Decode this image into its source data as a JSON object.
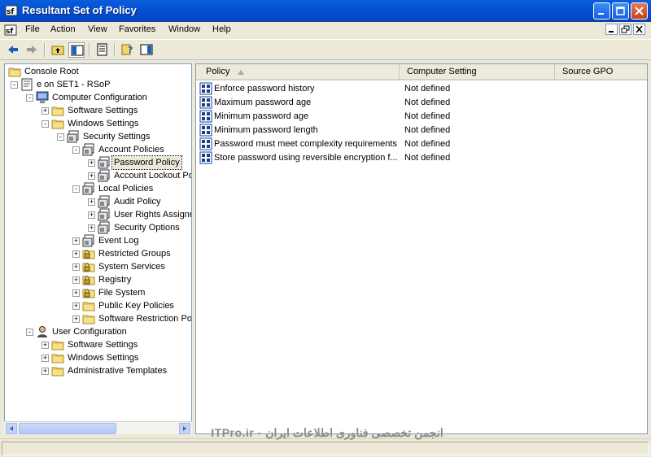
{
  "window": {
    "title": "Resultant Set of Policy"
  },
  "menu": [
    "File",
    "Action",
    "View",
    "Favorites",
    "Window",
    "Help"
  ],
  "tree": [
    {
      "label": "Console Root",
      "level": 0,
      "expander": "",
      "icon": "folder-icon"
    },
    {
      "label": "e on SET1 - RSoP",
      "level": 0,
      "expander": "-",
      "icon": "rsop-icon"
    },
    {
      "label": "Computer Configuration",
      "level": 1,
      "expander": "-",
      "icon": "computer-icon"
    },
    {
      "label": "Software Settings",
      "level": 2,
      "expander": "+",
      "icon": "folder-icon"
    },
    {
      "label": "Windows Settings",
      "level": 2,
      "expander": "-",
      "icon": "folder-icon"
    },
    {
      "label": "Security Settings",
      "level": 3,
      "expander": "-",
      "icon": "security-settings-icon"
    },
    {
      "label": "Account Policies",
      "level": 4,
      "expander": "-",
      "icon": "security-settings-icon"
    },
    {
      "label": "Password Policy",
      "level": 5,
      "expander": "+",
      "icon": "security-settings-icon",
      "selected": true
    },
    {
      "label": "Account Lockout Po",
      "level": 5,
      "expander": "+",
      "icon": "security-settings-icon"
    },
    {
      "label": "Local Policies",
      "level": 4,
      "expander": "-",
      "icon": "security-settings-icon"
    },
    {
      "label": "Audit Policy",
      "level": 5,
      "expander": "+",
      "icon": "security-settings-icon"
    },
    {
      "label": "User Rights Assignr",
      "level": 5,
      "expander": "+",
      "icon": "security-settings-icon"
    },
    {
      "label": "Security Options",
      "level": 5,
      "expander": "+",
      "icon": "security-settings-icon"
    },
    {
      "label": "Event Log",
      "level": 4,
      "expander": "+",
      "icon": "security-settings-icon"
    },
    {
      "label": "Restricted Groups",
      "level": 4,
      "expander": "+",
      "icon": "lock-folder-icon"
    },
    {
      "label": "System Services",
      "level": 4,
      "expander": "+",
      "icon": "lock-folder-icon"
    },
    {
      "label": "Registry",
      "level": 4,
      "expander": "+",
      "icon": "lock-folder-icon"
    },
    {
      "label": "File System",
      "level": 4,
      "expander": "+",
      "icon": "lock-folder-icon"
    },
    {
      "label": "Public Key Policies",
      "level": 4,
      "expander": "+",
      "icon": "folder-icon"
    },
    {
      "label": "Software Restriction Po",
      "level": 4,
      "expander": "+",
      "icon": "folder-icon"
    },
    {
      "label": "User Configuration",
      "level": 1,
      "expander": "-",
      "icon": "user-icon"
    },
    {
      "label": "Software Settings",
      "level": 2,
      "expander": "+",
      "icon": "folder-icon"
    },
    {
      "label": "Windows Settings",
      "level": 2,
      "expander": "+",
      "icon": "folder-icon"
    },
    {
      "label": "Administrative Templates",
      "level": 2,
      "expander": "+",
      "icon": "folder-icon"
    }
  ],
  "columns": [
    "Policy",
    "Computer Setting",
    "Source GPO"
  ],
  "rows": [
    {
      "policy": "Enforce password history",
      "setting": "Not defined"
    },
    {
      "policy": "Maximum password age",
      "setting": "Not defined"
    },
    {
      "policy": "Minimum password age",
      "setting": "Not defined"
    },
    {
      "policy": "Minimum password length",
      "setting": "Not defined"
    },
    {
      "policy": "Password must meet complexity requirements",
      "setting": "Not defined"
    },
    {
      "policy": "Store password using reversible encryption f...",
      "setting": "Not defined"
    }
  ],
  "watermark": "ITPro.ir - انجمن تخصصی فناوری اطلاعات ایران",
  "colors": {
    "title_bar": "#0452d4",
    "selection": "#ece9d8",
    "border": "#7f9db9"
  }
}
